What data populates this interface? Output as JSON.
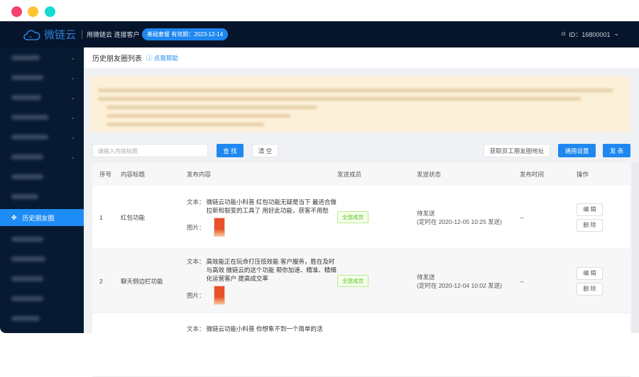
{
  "window": {
    "dot_colors": [
      "#f4406a",
      "#fdc430",
      "#16d9d2"
    ]
  },
  "header": {
    "brand": "微链云",
    "slogan": "用微链云 连接客户",
    "plan_badge": "基础套餐 有效期：2023-12-14",
    "user_id": "ID：16800001"
  },
  "sidebar": {
    "active_item": "历史朋友圈"
  },
  "page": {
    "title": "历史朋友圈列表",
    "help": "点我帮助"
  },
  "toolbar": {
    "search_placeholder": "请输入内容标题",
    "search": "查 找",
    "clear": "清 空",
    "get_url": "获取员工朋友圈地址",
    "settings": "通用设置",
    "publish": "发 表"
  },
  "table": {
    "headers": [
      "序号",
      "内容标题",
      "发布内容",
      "发送成员",
      "发送状态",
      "发布时间",
      "操作"
    ],
    "text_label": "文本：",
    "image_label": "图片：",
    "edit": "编 辑",
    "delete": "删 除",
    "rows": [
      {
        "index": "1",
        "title": "红包功能",
        "text": "微链云功能小科普 红包功能无疑是当下 最适合做拉新和裂变的工具了 用好此功能，获客不用愁",
        "members": "全部成员",
        "status": "待发送",
        "schedule": "(定时在 2020-12-05 10:25 发送)",
        "time": "--"
      },
      {
        "index": "2",
        "title": "聊天侧边栏功能",
        "text": "高效能正在玩命打压低效能 客户服务，胜在及时与高效 微链云的这个功能 帮你加速、精准、精细化运营客户 提高成交率",
        "members": "全部成员",
        "status": "待发送",
        "schedule": "(定时在 2020-12-04 10:02 发送)",
        "time": "--"
      },
      {
        "index": "",
        "title": "",
        "text": "微链云功能小科普 你想象不到一个简单的活",
        "members": "",
        "status": "",
        "schedule": "",
        "time": ""
      }
    ]
  }
}
